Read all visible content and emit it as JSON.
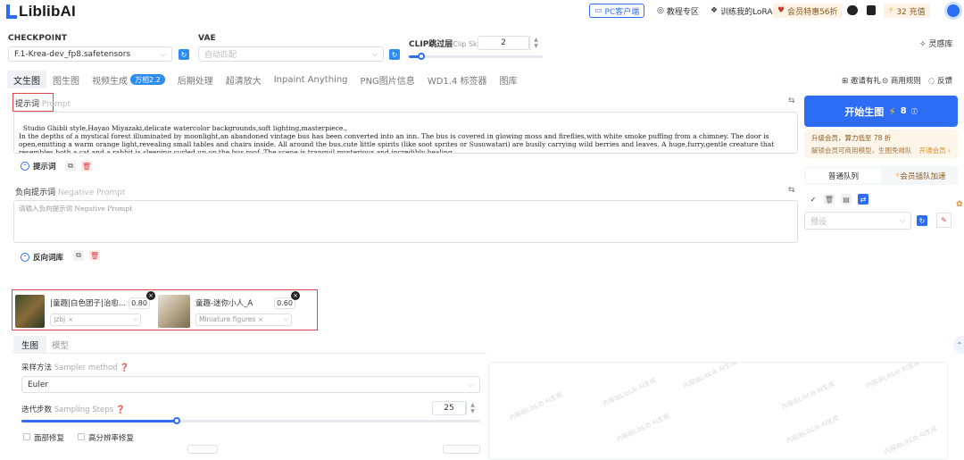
{
  "app": {
    "logo_text": "LiblibAI"
  },
  "topnav": {
    "pc_client": "PC客户端",
    "tutorial": "教程专区",
    "train_lora": "训练我的LoRA",
    "member": "会员特惠56折",
    "recharge": "32 充值"
  },
  "checkpoint": {
    "label": "CHECKPOINT",
    "value": "F.1-Krea-dev_fp8.safetensors"
  },
  "vae": {
    "label": "VAE",
    "placeholder": "自动匹配"
  },
  "clip": {
    "label": "CLIP跳过层",
    "label_en": "Clip Skip",
    "value": "2",
    "fraction": 0.1
  },
  "inspiration": "灵感库",
  "tabs": [
    "文生图",
    "图生图",
    "视频生成",
    "后期处理",
    "超清放大",
    "Inpaint Anything",
    "PNG图片信息",
    "WD1.4 标签器",
    "图库"
  ],
  "video_badge": "万相2.2",
  "right_tools": {
    "invite": "邀请有礼",
    "rules": "商用规则",
    "feedback": "反馈"
  },
  "prompt": {
    "label": "提示词",
    "label_en": "Prompt",
    "text": "Studio Ghibli style,Hayao Miyazaki,delicate watercolor backgrounds,soft lighting,masterpiece.,\nIn the depths of a mystical forest illuminated by moonlight,an abandoned vintage bus has been converted into an inn. The bus is covered in glowing moss and fireflies,with white smoke puffing from a chimney. The door is open,emitting a warm orange light,revealing small tables and chairs inside. All around the bus,cute little spirits (like soot sprites or Susuwatari) are busily carrying wild berries and leaves. A huge,furry,gentle creature that resembles both a cat and a rabbit is sleeping curled up on the bus roof. The scene is tranquil,mysterious,and incredibly healing.,",
    "toolbar_label": "提示词"
  },
  "negative": {
    "label": "负向提示词",
    "label_en": "Negative Prompt",
    "placeholder": "请输入负向提示词 Negative Prompt",
    "toolbar_label": "反向词库"
  },
  "generate": {
    "label": "开始生图",
    "cost": "8"
  },
  "upgrade": {
    "text": "升级会员，算力低至 78 折",
    "subtext": "解锁会员可商用模型，生图免排队",
    "link": "开通会员 ›"
  },
  "queue": {
    "normal": "普通队列",
    "member": "会员插队加速"
  },
  "preset": {
    "placeholder": "预设"
  },
  "loras": [
    {
      "name": "|童趣|白色团子|治愈...",
      "weight": "0.80",
      "tag": "jzbj"
    },
    {
      "name": "童趣-迷你小人_A",
      "weight": "0.60",
      "tag": "Miniature figures"
    }
  ],
  "gen_tabs": [
    "生图",
    "模型"
  ],
  "sampler": {
    "label": "采样方法",
    "label_en": "Sampler method",
    "value": "Euler"
  },
  "steps": {
    "label": "迭代步数",
    "label_en": "Sampling Steps",
    "value": "25",
    "fraction": 0.34
  },
  "options": {
    "face_fix": "面部修复",
    "hires": "高分辨率修复"
  },
  "watermark": "内容由LibLib AI生成",
  "colors": {
    "accent": "#2d6cf5",
    "highlight_border": "#e0434b"
  }
}
